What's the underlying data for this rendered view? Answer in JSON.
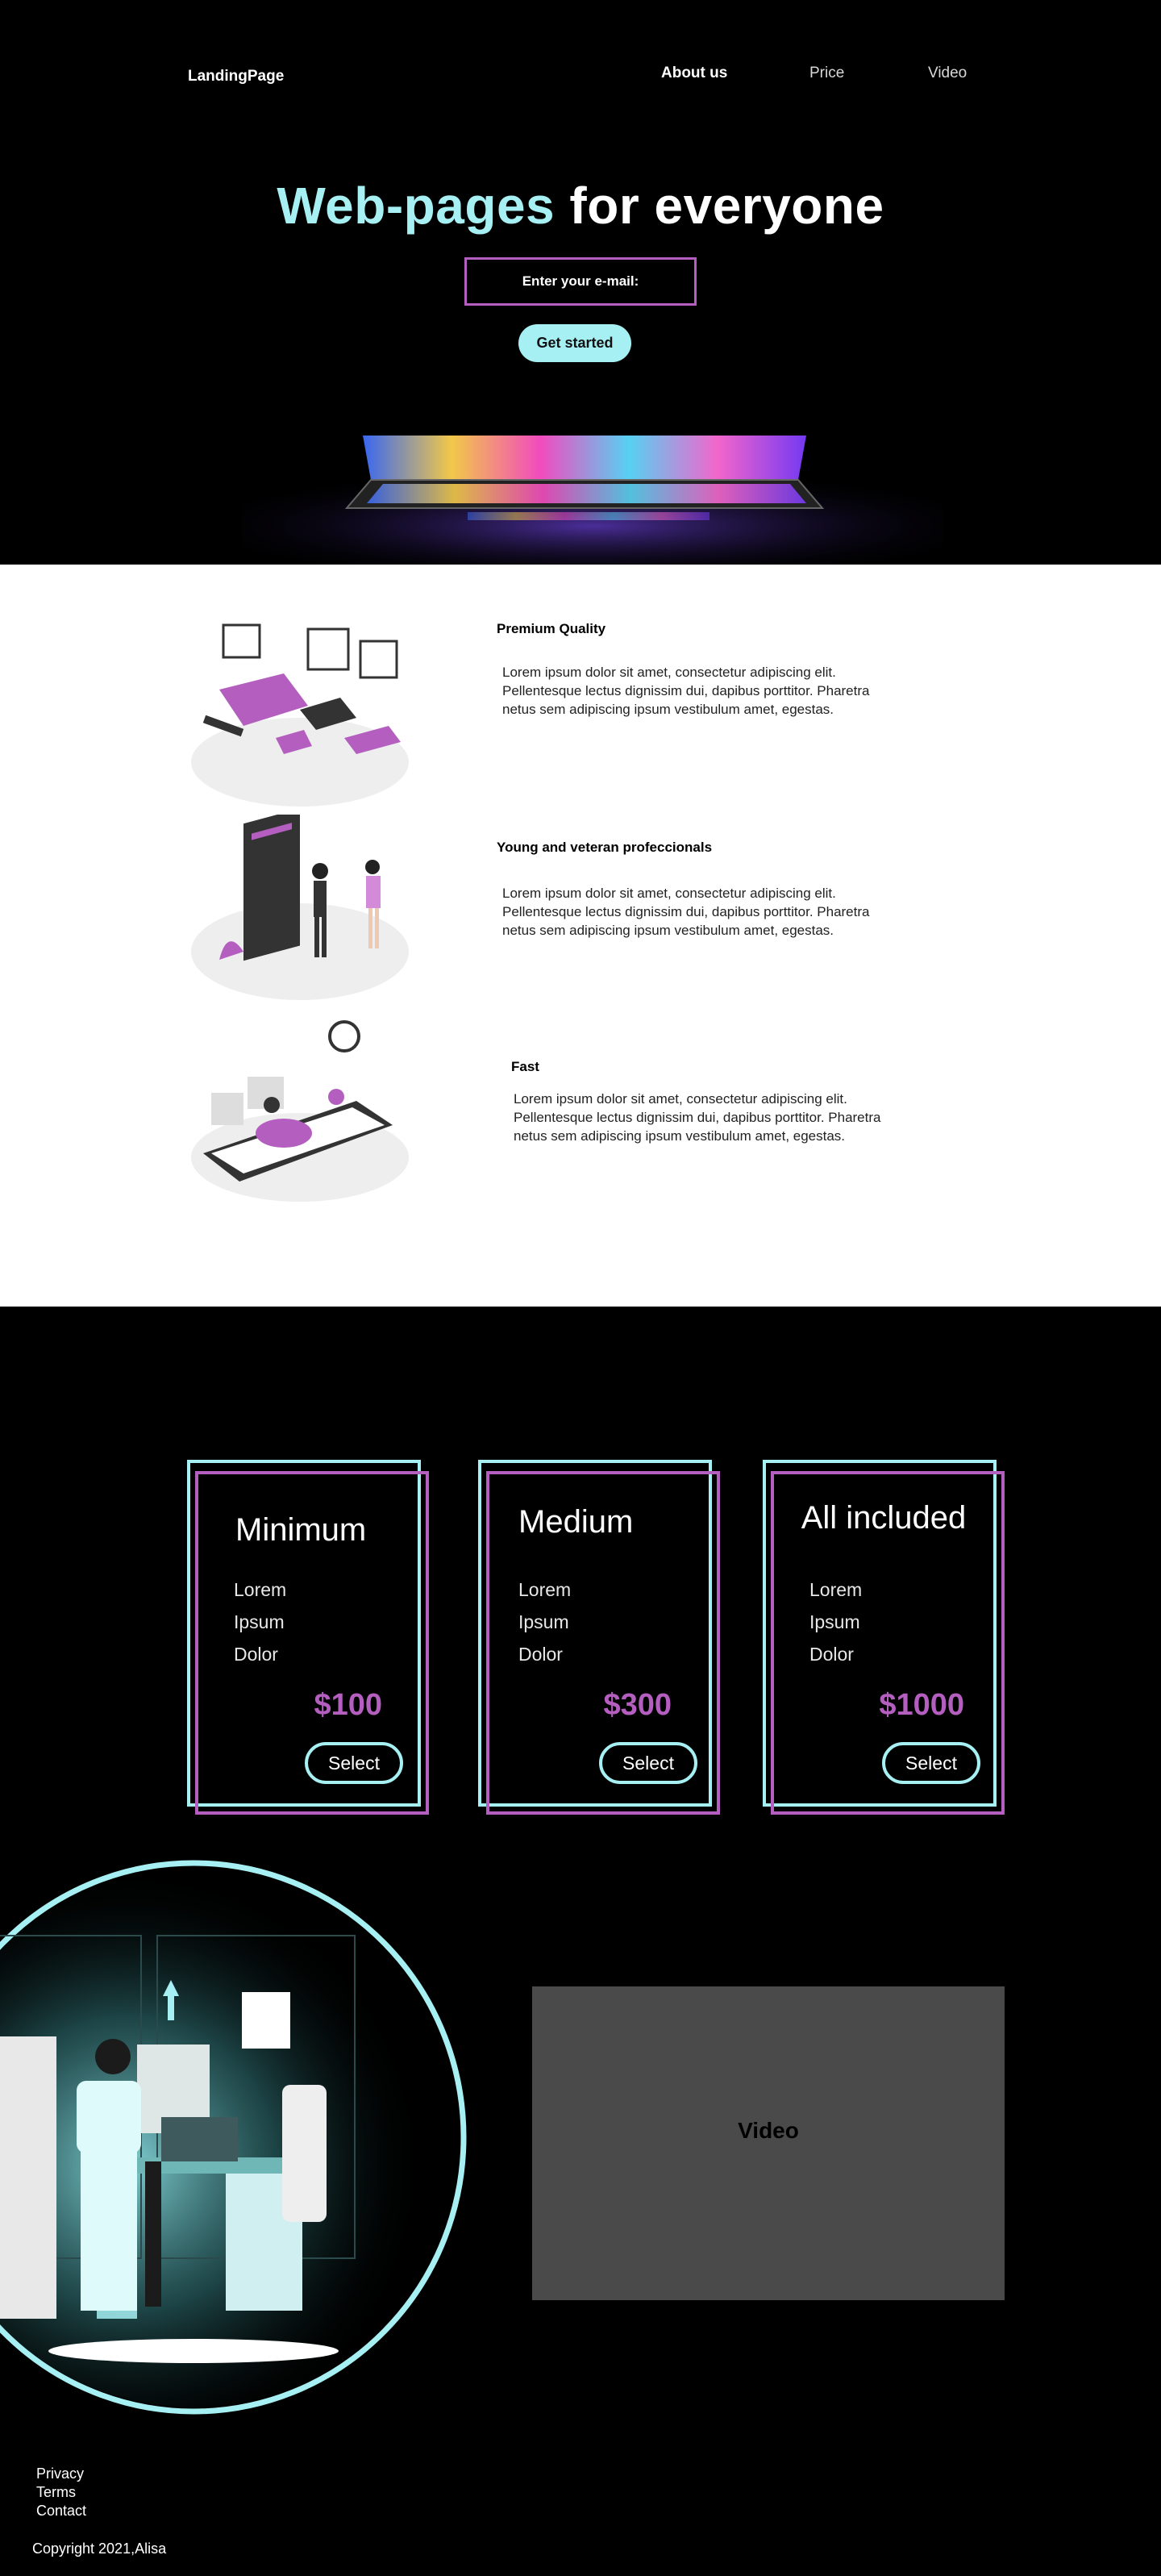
{
  "colors": {
    "accent_cyan": "#a6f0f3",
    "accent_purple": "#b45fc0",
    "background": "#000000",
    "features_bg": "#ffffff",
    "video_placeholder": "#4a4a4a"
  },
  "header": {
    "logo": "LandingPage",
    "nav": [
      {
        "label": "About us"
      },
      {
        "label": "Price"
      },
      {
        "label": "Video"
      }
    ]
  },
  "hero": {
    "title_accent": "Web-pages",
    "title_rest": "for everyone",
    "email_placeholder": "Enter your e-mail:",
    "cta_label": "Get started"
  },
  "features": [
    {
      "title": "Premium Quality",
      "text": "Lorem ipsum dolor sit amet, consectetur adipiscing elit. Pellentesque lectus dignissim dui, dapibus porttitor. Pharetra netus sem adipiscing ipsum vestibulum amet, egestas.",
      "icon": "devices-illustration"
    },
    {
      "title": "Young and veteran profeccionals",
      "text": "Lorem ipsum dolor sit amet, consectetur adipiscing elit. Pellentesque lectus dignissim dui, dapibus porttitor. Pharetra netus sem adipiscing ipsum vestibulum amet, egestas.",
      "icon": "handshake-illustration"
    },
    {
      "title": "Fast",
      "text": "Lorem ipsum dolor sit amet, consectetur adipiscing elit. Pellentesque lectus dignissim dui, dapibus porttitor. Pharetra netus sem adipiscing ipsum vestibulum amet, egestas.",
      "icon": "delivery-scooter-illustration"
    }
  ],
  "pricing": [
    {
      "name": "Minimum",
      "features": [
        "Lorem",
        "Ipsum",
        "Dolor"
      ],
      "price": "$100",
      "button": "Select"
    },
    {
      "name": "Medium",
      "features": [
        "Lorem",
        "Ipsum",
        "Dolor"
      ],
      "price": "$300",
      "button": "Select"
    },
    {
      "name": "All included",
      "features": [
        "Lorem",
        "Ipsum",
        "Dolor"
      ],
      "price": "$1000",
      "button": "Select"
    }
  ],
  "video": {
    "label": "Video"
  },
  "footer": {
    "links": [
      "Privacy",
      "Terms",
      "Contact"
    ],
    "copyright": "Copyright 2021,Alisa"
  }
}
